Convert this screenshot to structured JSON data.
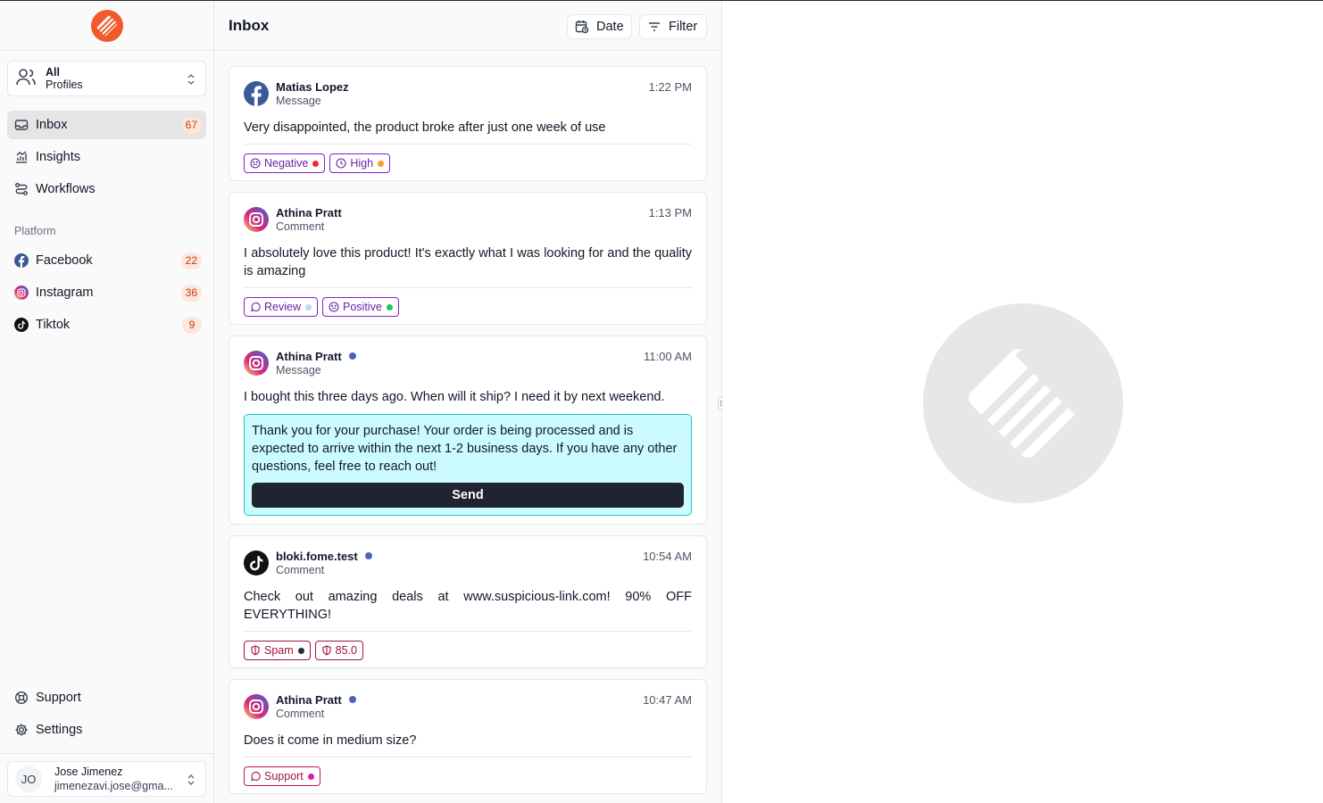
{
  "sidebar": {
    "profile": {
      "line1": "All",
      "line2": "Profiles"
    },
    "nav": [
      {
        "label": "Inbox",
        "badge": "67",
        "icon": "inbox-icon"
      },
      {
        "label": "Insights",
        "icon": "chart-icon"
      },
      {
        "label": "Workflows",
        "icon": "workflow-icon"
      }
    ],
    "platform_label": "Platform",
    "platforms": [
      {
        "label": "Facebook",
        "badge": "22",
        "icon": "facebook-icon"
      },
      {
        "label": "Instagram",
        "badge": "36",
        "icon": "instagram-icon"
      },
      {
        "label": "Tiktok",
        "badge": "9",
        "icon": "tiktok-icon"
      }
    ],
    "bottom": [
      {
        "label": "Support",
        "icon": "lifebuoy-icon"
      },
      {
        "label": "Settings",
        "icon": "gear-icon"
      }
    ],
    "user": {
      "initials": "JO",
      "name": "Jose Jimenez",
      "email": "jimenezavi.jose@gma..."
    }
  },
  "inbox": {
    "title": "Inbox",
    "date_label": "Date",
    "filter_label": "Filter",
    "messages": [
      {
        "name": "Matias Lopez",
        "type": "Message",
        "time": "1:22 PM",
        "platform": "facebook",
        "text": "Very disappointed, the product broke after just one week of use",
        "tags": [
          {
            "label": "Negative",
            "dot": "#ef2b2b"
          },
          {
            "label": "High",
            "dot": "#f59e2f"
          }
        ]
      },
      {
        "name": "Athina Pratt",
        "type": "Comment",
        "time": "1:13 PM",
        "platform": "instagram",
        "text": "I absolutely love this product! It's exactly what I was looking for and the quality is amazing",
        "tags": [
          {
            "label": "Review",
            "dot": "#b9d8f6"
          },
          {
            "label": "Positive",
            "dot": "#22c55e"
          }
        ]
      },
      {
        "name": "Athina Pratt",
        "type": "Message",
        "time": "11:00 AM",
        "platform": "instagram",
        "text": "I bought this three days ago. When will it ship? I need it by next weekend.",
        "reply": "Thank you for your purchase! Your order is being processed and is expected to arrive within the next 1-2 business days. If you have any other questions, feel free to reach out!",
        "send_label": "Send"
      },
      {
        "name": "bloki.fome.test",
        "type": "Comment",
        "time": "10:54 AM",
        "platform": "tiktok",
        "text": "Check out amazing deals at www.suspicious-link.com! 90% OFF EVERYTHING!",
        "tags": [
          {
            "label": "Spam",
            "dot": "#1f2d3d"
          },
          {
            "label": "85.0"
          }
        ]
      },
      {
        "name": "Athina Pratt",
        "type": "Comment",
        "time": "10:47 AM",
        "platform": "instagram",
        "text": "Does it come in medium size?",
        "tags": [
          {
            "label": "Support",
            "dot": "#e11d9c"
          }
        ]
      }
    ]
  },
  "colors": {
    "brand": "#f1592a",
    "unread_dot": "#4f5fbf",
    "reply_bg": "#ccfbfe",
    "badge_bg": "#fde7dc"
  }
}
